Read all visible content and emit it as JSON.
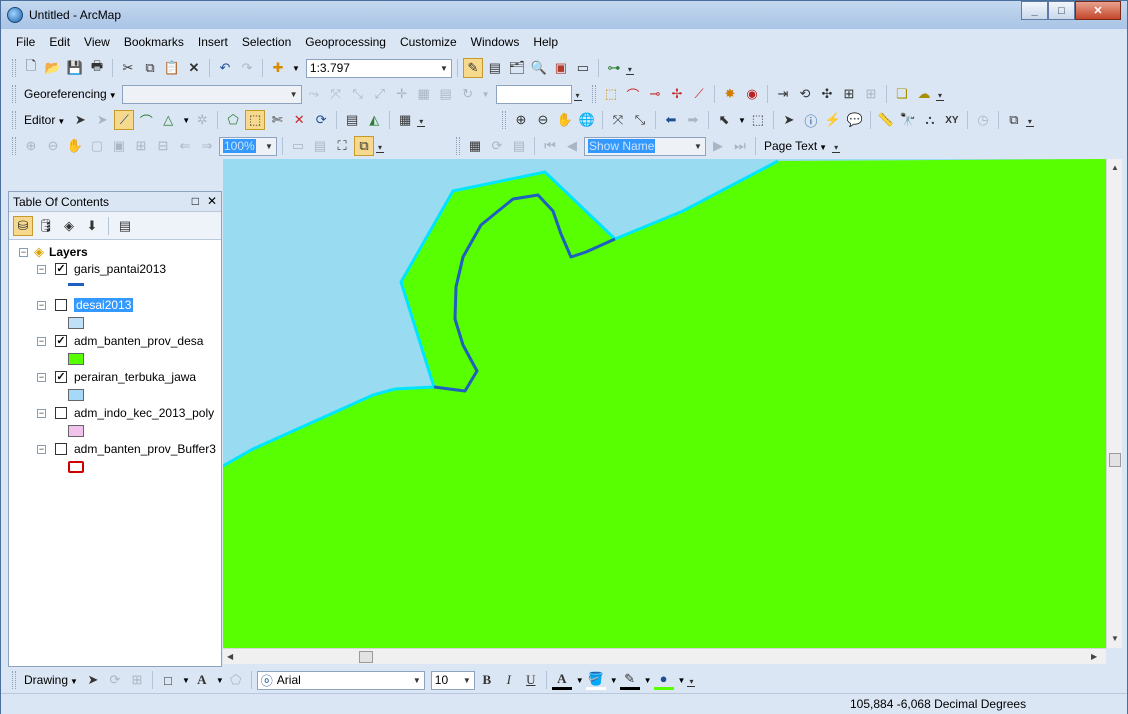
{
  "window": {
    "title": "Untitled - ArcMap"
  },
  "menu": [
    "File",
    "Edit",
    "View",
    "Bookmarks",
    "Insert",
    "Selection",
    "Geoprocessing",
    "Customize",
    "Windows",
    "Help"
  ],
  "standard_toolbar": {
    "scale": "1:3.797"
  },
  "georef_toolbar": {
    "label": "Georeferencing",
    "layer_value": "",
    "value_box": ""
  },
  "editor_toolbar": {
    "label": "Editor"
  },
  "layout_toolbar": {
    "zoom_value": "100%",
    "show_name": "Show Name",
    "page_text": "Page Text"
  },
  "toc": {
    "title": "Table Of Contents",
    "root": "Layers",
    "layers": [
      {
        "name": "garis_pantai2013",
        "checked": true,
        "symbol": "line",
        "color": "#1f5fbf"
      },
      {
        "name": "desai2013",
        "checked": false,
        "symbol": "fill",
        "color": "#bfe0f7",
        "highlighted": true
      },
      {
        "name": "adm_banten_prov_desa",
        "checked": true,
        "symbol": "fill",
        "color": "#57ff00"
      },
      {
        "name": "perairan_terbuka_jawa",
        "checked": true,
        "symbol": "fill",
        "color": "#a6d9f7"
      },
      {
        "name": "adm_indo_kec_2013_poly",
        "checked": false,
        "symbol": "fill",
        "color": "#f0c2ec"
      },
      {
        "name": "adm_banten_prov_Buffer3",
        "checked": false,
        "symbol": "outline",
        "color": "#cc0000"
      }
    ]
  },
  "map": {
    "land_color": "#57ff00",
    "water_color": "#99dbf1",
    "coast_color": "#00e5ff",
    "line_color": "#1f5fbf"
  },
  "drawing_toolbar": {
    "label": "Drawing",
    "font": "Arial",
    "size": "10"
  },
  "status": {
    "coords": "105,884  -6,068 Decimal Degrees"
  }
}
